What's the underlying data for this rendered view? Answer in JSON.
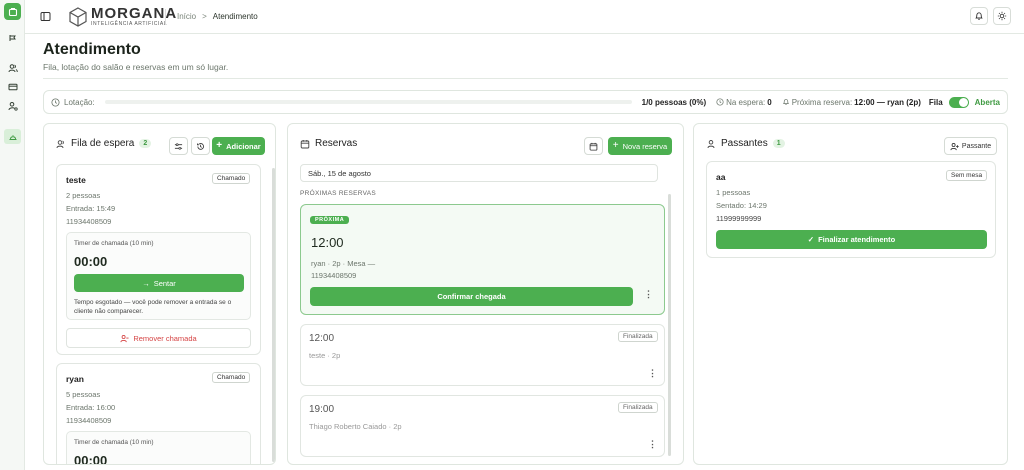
{
  "colors": {
    "accent": "#4caf50",
    "danger": "#d54545"
  },
  "brand": {
    "name": "MORGANA",
    "subtitle": "INTELIGÊNCIA ARTIFICIAL"
  },
  "breadcrumb": {
    "home": "Início",
    "separator": ">",
    "current": "Atendimento"
  },
  "page": {
    "title": "Atendimento",
    "subtitle": "Fila, lotação do salão e reservas em um só lugar."
  },
  "status_bar": {
    "lotacao_label": "Lotação:",
    "lotacao_fraction": 0,
    "lotacao_value": "1/0 pessoas (0%)",
    "espera_label": "Na espera:",
    "espera_value": "0",
    "proxima_label": "Próxima reserva:",
    "proxima_value": "12:00 — ryan (2p)",
    "fila_label": "Fila",
    "fila_state": "Aberta"
  },
  "fila": {
    "title": "Fila de espera",
    "count": "2",
    "add_label": "Adicionar",
    "items": [
      {
        "name": "teste",
        "tag": "Chamado",
        "people": "2 pessoas",
        "entry": "Entrada: 15:49",
        "phone": "11934408509",
        "timer_label": "Timer de chamada (10 min)",
        "timer_value": "00:00",
        "seat_label": "Sentar",
        "note": "Tempo esgotado — você pode remover a entrada se o cliente não comparecer.",
        "remove_label": "Remover chamada"
      },
      {
        "name": "ryan",
        "tag": "Chamado",
        "people": "5 pessoas",
        "entry": "Entrada: 16:00",
        "phone": "11934408509",
        "timer_label": "Timer de chamada (10 min)",
        "timer_value": "00:00"
      }
    ]
  },
  "reservas": {
    "title": "Reservas",
    "new_label": "Nova reserva",
    "date": "Sáb., 15 de agosto",
    "section": "PRÓXIMAS RESERVAS",
    "next": {
      "badge": "PRÓXIMA",
      "time": "12:00",
      "detail": "ryan · 2p · Mesa —",
      "phone": "11934408509",
      "confirm_label": "Confirmar chegada"
    },
    "items": [
      {
        "time": "12:00",
        "status": "Finalizada",
        "detail": "teste · 2p"
      },
      {
        "time": "19:00",
        "status": "Finalizada",
        "detail": "Thiago Roberto Caiado · 2p"
      }
    ]
  },
  "passantes": {
    "title": "Passantes",
    "count": "1",
    "add_label": "Passante",
    "items": [
      {
        "name": "aa",
        "tag": "Sem mesa",
        "people": "1 pessoas",
        "seated": "Sentado: 14:29",
        "phone": "11999999999",
        "finish_label": "Finalizar atendimento"
      }
    ]
  }
}
